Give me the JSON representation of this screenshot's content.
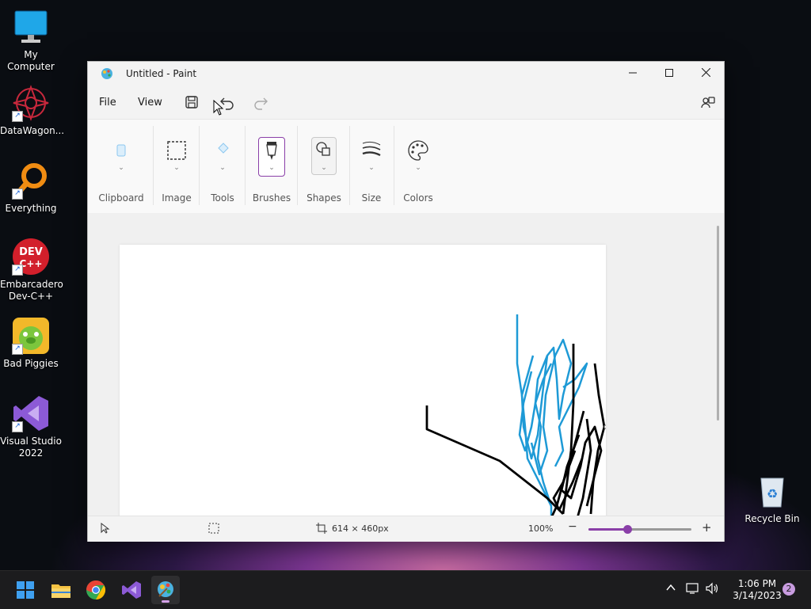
{
  "desktop": {
    "icons": [
      {
        "label": "My Computer"
      },
      {
        "label": "DataWagon..."
      },
      {
        "label": "Everything"
      },
      {
        "label": "Embarcadero Dev-C++"
      },
      {
        "label": "Bad Piggies"
      },
      {
        "label": "Visual Studio 2022"
      },
      {
        "label": "Recycle Bin"
      }
    ],
    "devcpp_badge": "DEV\nC++"
  },
  "window": {
    "title": "Untitled - Paint",
    "menu": {
      "file": "File",
      "view": "View"
    },
    "ribbon": {
      "clipboard": "Clipboard",
      "image": "Image",
      "tools": "Tools",
      "brushes": "Brushes",
      "shapes": "Shapes",
      "size": "Size",
      "colors": "Colors"
    },
    "status": {
      "canvas_size": "614 × 460px",
      "zoom": "100%",
      "zoom_fraction": 0.38
    },
    "colors": {
      "accent": "#8a3fa8",
      "stroke_blue": "#1e9ad6",
      "stroke_black": "#000000"
    }
  },
  "taskbar": {
    "apps": [
      "start-icon",
      "file-explorer-icon",
      "chrome-icon",
      "visual-studio-icon",
      "paint-icon"
    ],
    "time": "1:06 PM",
    "date": "3/14/2023",
    "notifications": "2"
  }
}
